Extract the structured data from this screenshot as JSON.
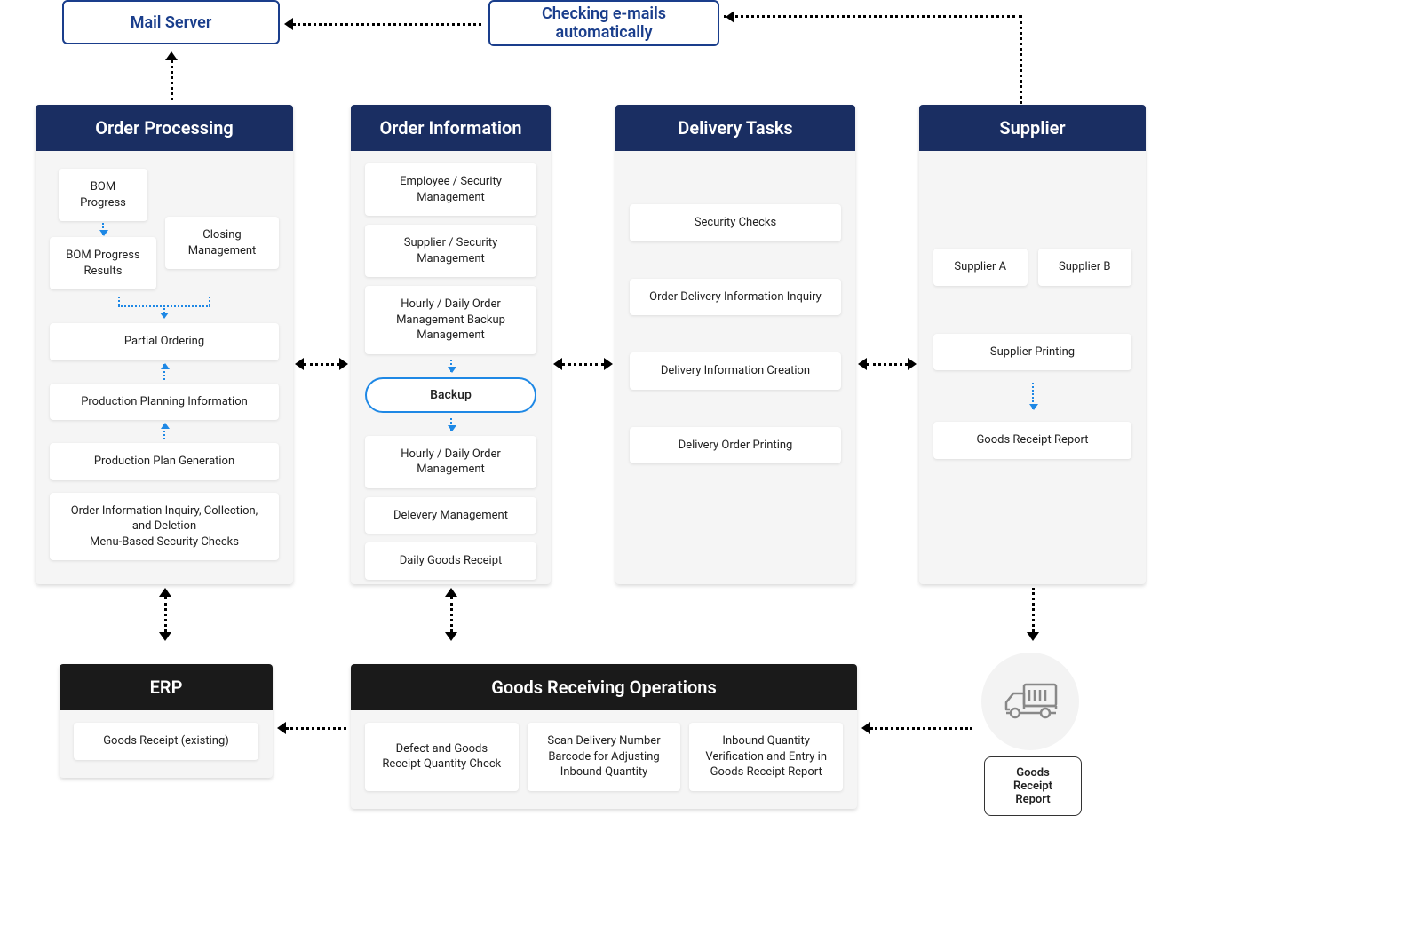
{
  "top": {
    "mail_server": "Mail Server",
    "checking_emails": "Checking e-mails automatically"
  },
  "order_processing": {
    "title": "Order Processing",
    "bom_progress": "BOM Progress",
    "bom_progress_results": "BOM Progress Results",
    "closing_management": "Closing Management",
    "partial_ordering": "Partial Ordering",
    "production_planning_info": "Production Planning Information",
    "production_plan_generation": "Production Plan Generation",
    "order_info_inquiry": "Order Information Inquiry, Collection, and Deletion\nMenu-Based Security Checks"
  },
  "order_information": {
    "title": "Order Information",
    "employee_security": "Employee / Security Management",
    "supplier_security": "Supplier / Security Management",
    "hourly_daily_backup": "Hourly / Daily Order Management Backup Management",
    "backup": "Backup",
    "hourly_daily": "Hourly / Daily Order Management",
    "delivery_management": "Delevery Management",
    "daily_goods_receipt": "Daily Goods Receipt"
  },
  "delivery_tasks": {
    "title": "Delivery Tasks",
    "security_checks": "Security Checks",
    "order_delivery_inquiry": "Order Delivery Information Inquiry",
    "delivery_info_creation": "Delivery Information Creation",
    "delivery_order_printing": "Delivery Order Printing"
  },
  "supplier": {
    "title": "Supplier",
    "supplier_a": "Supplier A",
    "supplier_b": "Supplier B",
    "supplier_printing": "Supplier Printing",
    "goods_receipt_report": "Goods Receipt Report"
  },
  "erp": {
    "title": "ERP",
    "goods_receipt_existing": "Goods Receipt (existing)"
  },
  "goods_receiving": {
    "title": "Goods Receiving Operations",
    "defect_check": "Defect and Goods Receipt Quantity Check",
    "scan_barcode": "Scan Delivery Number Barcode for Adjusting Inbound Quantity",
    "inbound_verification": "Inbound Quantity Verification and Entry in Goods Receipt Report"
  },
  "bottom": {
    "goods_receipt_report": "Goods Receipt Report"
  }
}
